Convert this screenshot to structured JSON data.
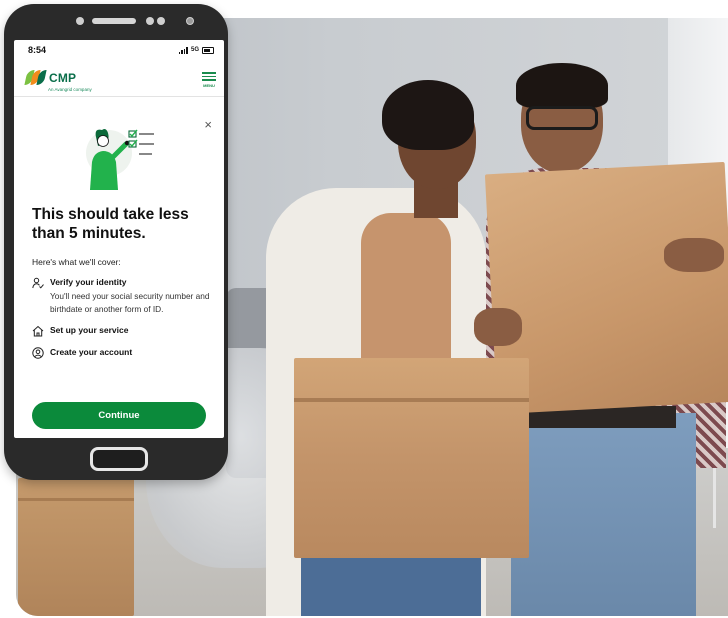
{
  "phone": {
    "status_time": "8:54",
    "network": "5G",
    "brand_name": "CMP",
    "brand_tagline": "An Avangrid company",
    "menu_label": "MENU",
    "close_symbol": "×",
    "heading": "This should take less than 5 minutes.",
    "intro": "Here's what we'll cover:",
    "items": [
      {
        "icon": "verify-identity-icon",
        "title": "Verify your identity",
        "description": "You'll need your social security number and birthdate or another form of ID."
      },
      {
        "icon": "home-icon",
        "title": "Set up your service"
      },
      {
        "icon": "account-icon",
        "title": "Create your account"
      }
    ],
    "continue_label": "Continue"
  },
  "colors": {
    "brand_green": "#0b8a3b",
    "logo_green": "#0a6e4a",
    "logo_orange": "#f28c1c",
    "logo_lime": "#7cc142"
  },
  "photo": {
    "subject": "Two smiling people holding moving boxes in a new home"
  }
}
